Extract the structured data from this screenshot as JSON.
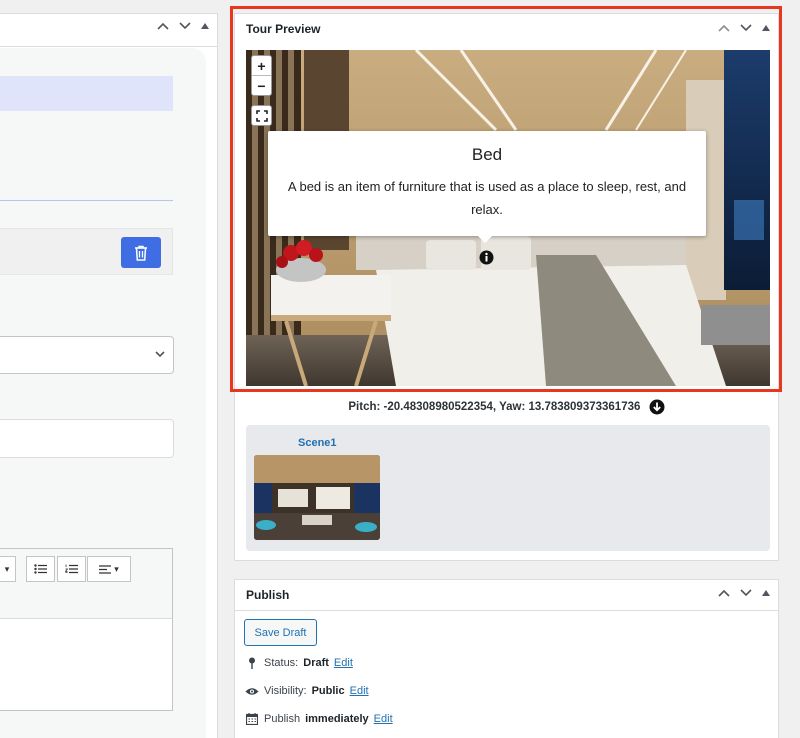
{
  "tour_preview": {
    "title": "Tour Preview",
    "hotspot": {
      "title": "Bed",
      "description": "A bed is an item of furniture that is used as a place to sleep, rest, and relax."
    },
    "zoom_in": "+",
    "zoom_out": "−",
    "pitch_yaw": "Pitch: -20.48308980522354, Yaw: 13.783809373361736",
    "scenes": [
      {
        "name": "Scene1"
      }
    ]
  },
  "publish": {
    "title": "Publish",
    "save_draft": "Save Draft",
    "status_label": "Status:",
    "status_value": "Draft",
    "status_edit": "Edit",
    "visibility_label": "Visibility:",
    "visibility_value": "Public",
    "visibility_edit": "Edit",
    "publish_label": "Publish",
    "publish_value": "immediately",
    "publish_edit": "Edit"
  },
  "colors": {
    "accent": "#2271b1",
    "highlight_frame": "#e8361f",
    "delete_button": "#3f6de4"
  },
  "icons": [
    "chevron-up-icon",
    "chevron-down-icon",
    "triangle-toggle-icon",
    "trash-icon",
    "fullscreen-icon",
    "info-icon",
    "download-arrow-icon",
    "pin-icon",
    "eye-icon",
    "calendar-icon",
    "bullet-list-icon",
    "numbered-list-icon",
    "align-icon"
  ]
}
